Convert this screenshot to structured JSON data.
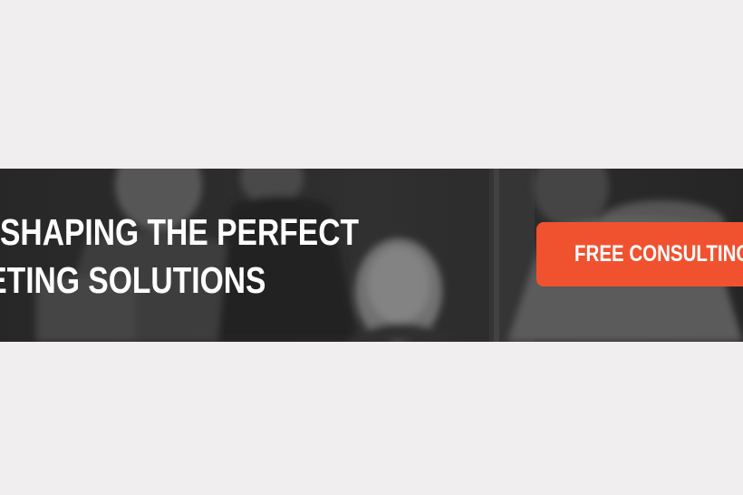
{
  "banner": {
    "headline": {
      "line_1": "SHAPING THE PERFECT",
      "line_2": "ETING SOLUTIONS"
    },
    "cta_label": "FREE CONSULTING",
    "colors": {
      "page_background": "#f0eeef",
      "banner_overlay": "#3a3a3a",
      "headline_text": "#ffffff",
      "cta_background": "#f0522f",
      "cta_text": "#ffffff"
    },
    "background_image": "grayscale-team-photo"
  }
}
